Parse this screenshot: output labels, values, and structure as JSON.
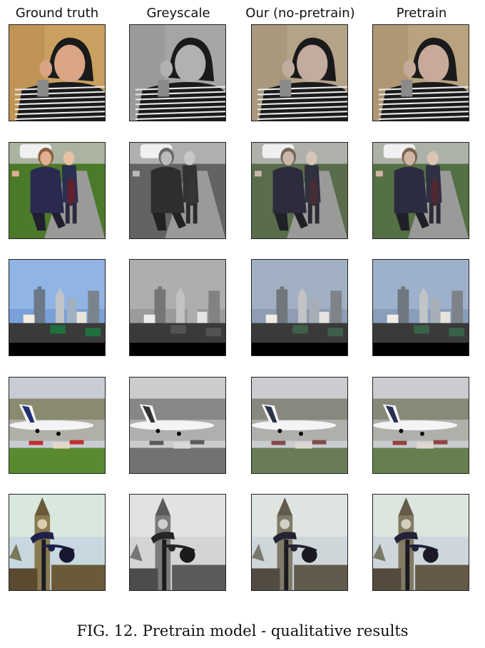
{
  "columns": [
    "Ground truth",
    "Greyscale",
    "Our (no-pretrain)",
    "Pretrain"
  ],
  "rows": [
    {
      "subject": "person-hoodie"
    },
    {
      "subject": "mother-child"
    },
    {
      "subject": "city-skyline"
    },
    {
      "subject": "airplane"
    },
    {
      "subject": "big-ben"
    }
  ],
  "caption": "FIG. 12. Pretrain model - qualitative results"
}
